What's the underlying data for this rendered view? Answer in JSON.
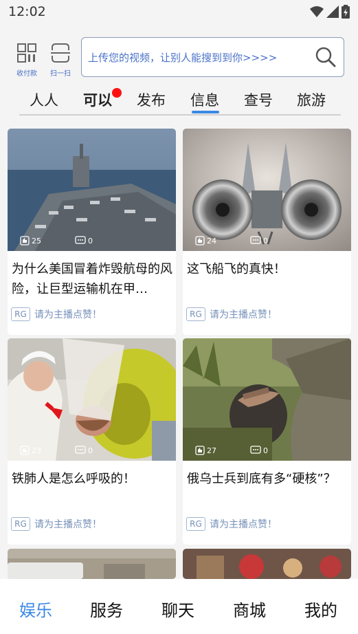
{
  "status": {
    "time": "12:02"
  },
  "header": {
    "pay_label": "收付款",
    "scan_label": "扫一扫",
    "search_placeholder": "上传您的视频，让别人能搜到到你>>>>"
  },
  "tabs": [
    {
      "label": "人人"
    },
    {
      "label": "可以",
      "badge": true
    },
    {
      "label": "发布"
    },
    {
      "label": "信息",
      "active": true
    },
    {
      "label": "查号"
    },
    {
      "label": "旅游"
    }
  ],
  "cards": [
    {
      "title": "为什么美国冒着炸毁航母的风险，让巨型运输机在甲…",
      "likes": "25",
      "comments": "0",
      "tag": "RG",
      "cta": "请为主播点赞！"
    },
    {
      "title": "这飞船飞的真快！",
      "likes": "24",
      "comments": "0",
      "tag": "RG",
      "cta": "请为主播点赞！"
    },
    {
      "title": "铁肺人是怎么呼吸的！",
      "likes": "23",
      "comments": "0",
      "tag": "RG",
      "cta": "请为主播点赞！"
    },
    {
      "title": "俄乌士兵到底有多“硬核”？",
      "likes": "27",
      "comments": "0",
      "tag": "RG",
      "cta": "请为主播点赞！"
    }
  ],
  "bottom_nav": [
    {
      "label": "娱乐",
      "active": true
    },
    {
      "label": "服务"
    },
    {
      "label": "聊天"
    },
    {
      "label": "商城"
    },
    {
      "label": "我的"
    }
  ],
  "colors": {
    "accent": "#3a88e5",
    "link": "#4a72c8",
    "badge": "#ff1010"
  }
}
